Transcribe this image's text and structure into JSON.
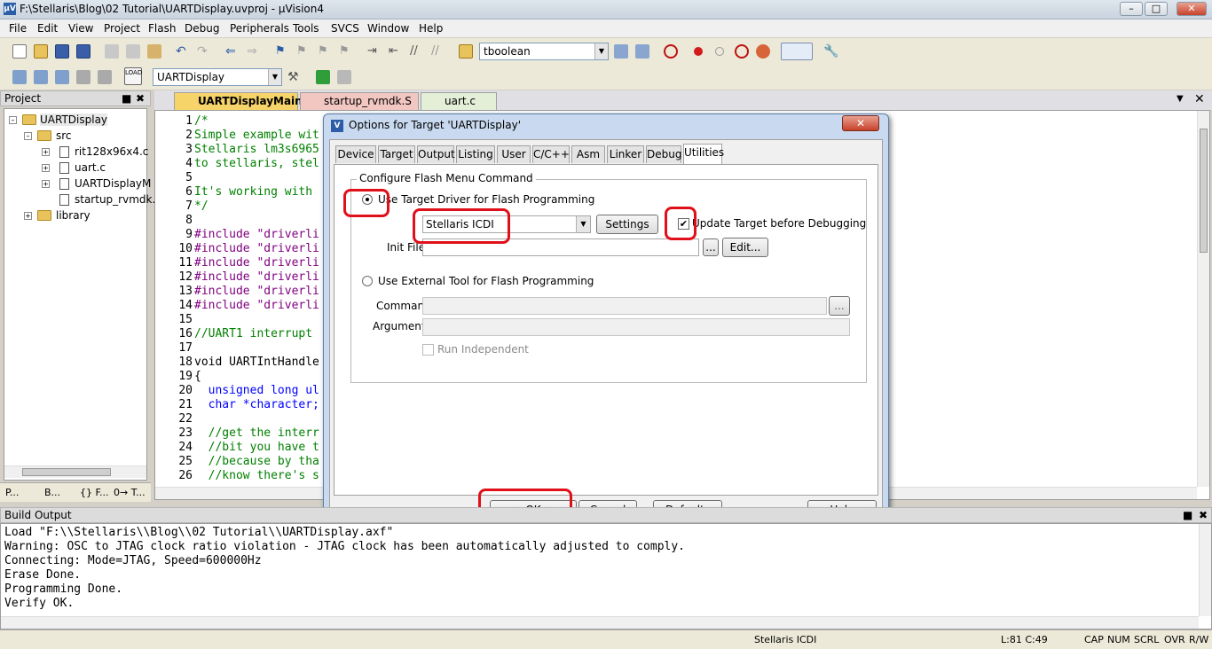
{
  "window": {
    "title": "F:\\Stellaris\\Blog\\02 Tutorial\\UARTDisplay.uvproj - µVision4",
    "app_icon": "µV"
  },
  "menu": [
    "File",
    "Edit",
    "View",
    "Project",
    "Flash",
    "Debug",
    "Peripherals",
    "Tools",
    "SVCS",
    "Window",
    "Help"
  ],
  "toolbar": {
    "find_combo": "tboolean",
    "target_combo": "UARTDisplay",
    "load_label": "LOAD"
  },
  "project_panel": {
    "title": "Project",
    "tree": {
      "root": "UARTDisplay",
      "src_folder": "src",
      "files": [
        "rit128x96x4.c",
        "uart.c",
        "UARTDisplayM",
        "startup_rvmdk."
      ],
      "library_folder": "library"
    },
    "tabs": [
      "P...",
      "B...",
      "{} F...",
      "0→ T..."
    ]
  },
  "editor": {
    "tabs": [
      "UARTDisplayMain.c",
      "startup_rvmdk.S",
      "uart.c"
    ],
    "lines": [
      {
        "n": "1",
        "text": "/*",
        "color": "#008000"
      },
      {
        "n": "2",
        "text": "Simple example wit",
        "color": "#008000"
      },
      {
        "n": "3",
        "text": "Stellaris lm3s6965",
        "color": "#008000"
      },
      {
        "n": "4",
        "text": "to stellaris, stel",
        "color": "#008000"
      },
      {
        "n": "5",
        "text": "",
        "color": "#000000"
      },
      {
        "n": "6",
        "text": "It's working with ",
        "color": "#008000"
      },
      {
        "n": "7",
        "text": "*/",
        "color": "#008000"
      },
      {
        "n": "8",
        "text": "",
        "color": "#000000"
      },
      {
        "n": "9",
        "text": "#include \"driverli",
        "color": "#800080"
      },
      {
        "n": "10",
        "text": "#include \"driverli",
        "color": "#800080"
      },
      {
        "n": "11",
        "text": "#include \"driverli",
        "color": "#800080"
      },
      {
        "n": "12",
        "text": "#include \"driverli",
        "color": "#800080"
      },
      {
        "n": "13",
        "text": "#include \"driverli",
        "color": "#800080"
      },
      {
        "n": "14",
        "text": "#include \"driverli",
        "color": "#800080"
      },
      {
        "n": "15",
        "text": "",
        "color": "#000000"
      },
      {
        "n": "16",
        "text": "//UART1 interrupt ",
        "color": "#008000"
      },
      {
        "n": "17",
        "text": "",
        "color": "#000000"
      },
      {
        "n": "18",
        "text": "void UARTIntHandle",
        "color": "#000000"
      },
      {
        "n": "19",
        "text": "{",
        "color": "#000000"
      },
      {
        "n": "20",
        "text": "  unsigned long ul",
        "color": "#0000ff"
      },
      {
        "n": "21",
        "text": "  char *character;",
        "color": "#0000ff"
      },
      {
        "n": "22",
        "text": "",
        "color": "#000000"
      },
      {
        "n": "23",
        "text": "  //get the interr",
        "color": "#008000"
      },
      {
        "n": "24",
        "text": "  //bit you have t",
        "color": "#008000"
      },
      {
        "n": "25",
        "text": "  //because by tha",
        "color": "#008000"
      },
      {
        "n": "26",
        "text": "  //know there's s",
        "color": "#008000"
      }
    ]
  },
  "dialog": {
    "title": "Options for Target 'UARTDisplay'",
    "tabs": [
      "Device",
      "Target",
      "Output",
      "Listing",
      "User",
      "C/C++",
      "Asm",
      "Linker",
      "Debug",
      "Utilities"
    ],
    "active_tab": "Utilities",
    "group_title": "Configure Flash Menu Command",
    "use_target_driver": "Use Target Driver for Flash Programming",
    "driver_select": "Stellaris ICDI",
    "settings_btn": "Settings",
    "update_target": "Update Target before Debugging",
    "init_file_label": "Init File:",
    "init_file_value": "",
    "browse": "...",
    "edit_btn": "Edit...",
    "use_external": "Use External Tool for Flash Programming",
    "command_label": "Command:",
    "arguments_label": "Arguments:",
    "run_independent": "Run Independent",
    "ok": "OK",
    "cancel": "Cancel",
    "defaults": "Defaults",
    "help": "Help"
  },
  "build_output": {
    "title": "Build Output",
    "lines": [
      "Load \"F:\\\\Stellaris\\\\Blog\\\\02 Tutorial\\\\UARTDisplay.axf\"",
      "Warning: OSC to JTAG clock ratio violation - JTAG clock has been automatically adjusted to comply.",
      "Connecting: Mode=JTAG, Speed=600000Hz",
      "Erase Done.",
      "Programming Done.",
      "Verify OK."
    ]
  },
  "status": {
    "debugger": "Stellaris ICDI",
    "position": "L:81 C:49",
    "flags": [
      "CAP",
      "NUM",
      "SCRL",
      "OVR",
      "R/W"
    ]
  }
}
